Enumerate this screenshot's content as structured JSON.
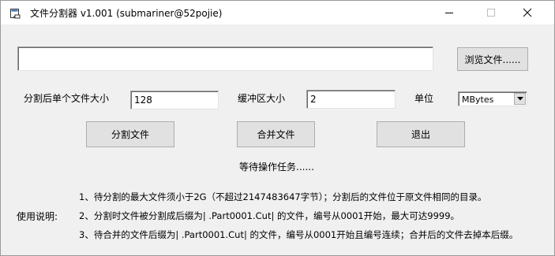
{
  "window": {
    "title": "文件分割器 v1.001 (submariner@52pojie)"
  },
  "file": {
    "path_value": "",
    "browse_label": "浏览文件......"
  },
  "settings": {
    "split_size_label": "分割后单个文件大小",
    "split_size_value": "128",
    "buffer_label": "缓冲区大小",
    "buffer_value": "2",
    "unit_label": "单位",
    "unit_selected": "MBytes"
  },
  "actions": {
    "split_label": "分割文件",
    "merge_label": "合并文件",
    "exit_label": "退出"
  },
  "status": "等待操作任务......",
  "instructions": {
    "heading": "使用说明:",
    "lines": [
      "1、待分割的最大文件须小于2G（不超过2147483647字节）；分割后的文件位于原文件相同的目录。",
      "2、分割时文件被分割成后缀为| .Part0001.Cut| 的文件，编号从0001开始，最大可达9999。",
      "3、待合并的文件后缀为| .Part0001.Cut| 的文件，编号从0001开始且编号连续；合并后的文件去掉本后缀。"
    ]
  }
}
